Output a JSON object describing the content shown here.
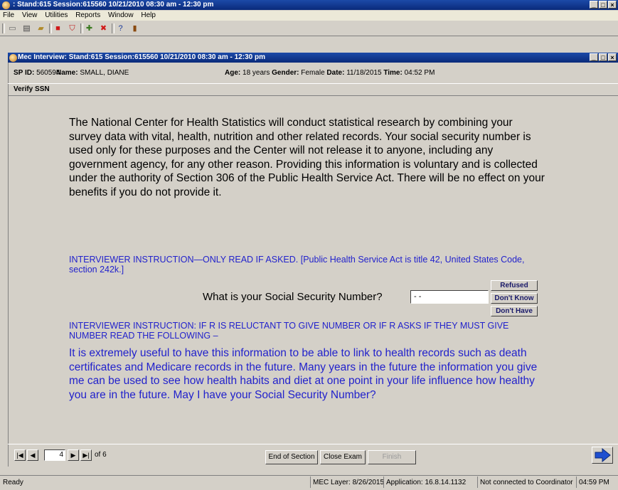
{
  "app": {
    "title": ": Stand:615 Session:615560 10/21/2010 08:30 am - 12:30 pm",
    "menu": [
      "File",
      "View",
      "Utilities",
      "Reports",
      "Window",
      "Help"
    ]
  },
  "child": {
    "title": "Mec Interview: Stand:615 Session:615560 10/21/2010 08:30 am - 12:30 pm"
  },
  "participant": {
    "sp_id_label": "SP ID:",
    "sp_id": "560594",
    "name_label": "Name:",
    "name": "SMALL, DIANE",
    "age_label": "Age:",
    "age": "18 years",
    "gender_label": "Gender:",
    "gender": "Female",
    "date_label": "Date:",
    "date": "11/18/2015",
    "time_label": "Time:",
    "time": "04:52 PM"
  },
  "section": {
    "title": "Verify SSN"
  },
  "content": {
    "intro": "The National Center for Health Statistics will conduct statistical research by combining your survey data with vital, health, nutrition and other related records. Your social security number is used only for these purposes and the Center will not release it to anyone, including any government agency, for any other reason. Providing this information is voluntary and is collected under the authority of Section 306 of the Public Health Service Act. There will be no effect on your benefits if you do not provide it.",
    "instruction1": "INTERVIEWER INSTRUCTION—ONLY READ IF ASKED.  [Public Health Service Act is title 42, United States Code, section 242k.]",
    "question": "What is your Social Security Number?",
    "ssn_value": " - -",
    "instruction2": "INTERVIEWER INSTRUCTION: IF R IS RELUCTANT TO GIVE NUMBER OR IF R ASKS IF THEY MUST GIVE NUMBER READ THE FOLLOWING –",
    "followup": "It is extremely useful to have this information to be able to link to health records such as death certificates and Medicare records in the future. Many years in the future the information you give me can be used to see how health habits and diet at one point in your life influence how healthy you are in the future. May I have your Social Security Number?"
  },
  "buttons": {
    "refused": "Refused",
    "dont_know": "Don't Know",
    "dont_have": "Don't Have",
    "end_of_section": "End of Section",
    "close_exam": "Close Exam",
    "finish": "Finish"
  },
  "nav": {
    "page": "4",
    "of_label": "of 6"
  },
  "status": {
    "left": "Ready",
    "mec_layer": "MEC Layer: 8/26/2015",
    "application": "Application: 16.8.14.1132",
    "coordinator": "Not connected to Coordinator",
    "clock": "04:59 PM"
  }
}
